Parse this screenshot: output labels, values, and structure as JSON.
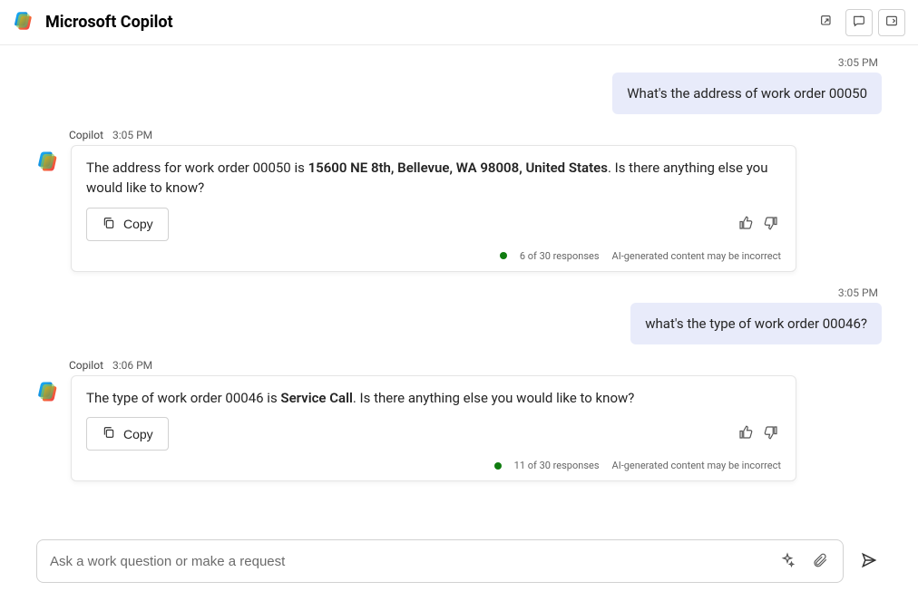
{
  "header": {
    "app_title": "Microsoft Copilot"
  },
  "chat": [
    {
      "role": "user",
      "timestamp": "3:05 PM",
      "text": "What's the address of work order 00050"
    },
    {
      "role": "bot",
      "sender": "Copilot",
      "timestamp": "3:05 PM",
      "text_prefix": "The address for work order 00050 is ",
      "text_bold": "15600 NE 8th, Bellevue, WA 98008, United States",
      "text_suffix": ". Is there anything else you would like to know?",
      "copy_label": "Copy",
      "counter": "6 of 30 responses",
      "disclaimer": "AI-generated content may be incorrect"
    },
    {
      "role": "user",
      "timestamp": "3:05 PM",
      "text": "what's the type of work order 00046?"
    },
    {
      "role": "bot",
      "sender": "Copilot",
      "timestamp": "3:06 PM",
      "text_prefix": "The type of work order 00046 is ",
      "text_bold": "Service Call",
      "text_suffix": ". Is there anything else you would like to know?",
      "copy_label": "Copy",
      "counter": "11 of 30 responses",
      "disclaimer": "AI-generated content may be incorrect"
    }
  ],
  "composer": {
    "placeholder": "Ask a work question or make a request"
  }
}
